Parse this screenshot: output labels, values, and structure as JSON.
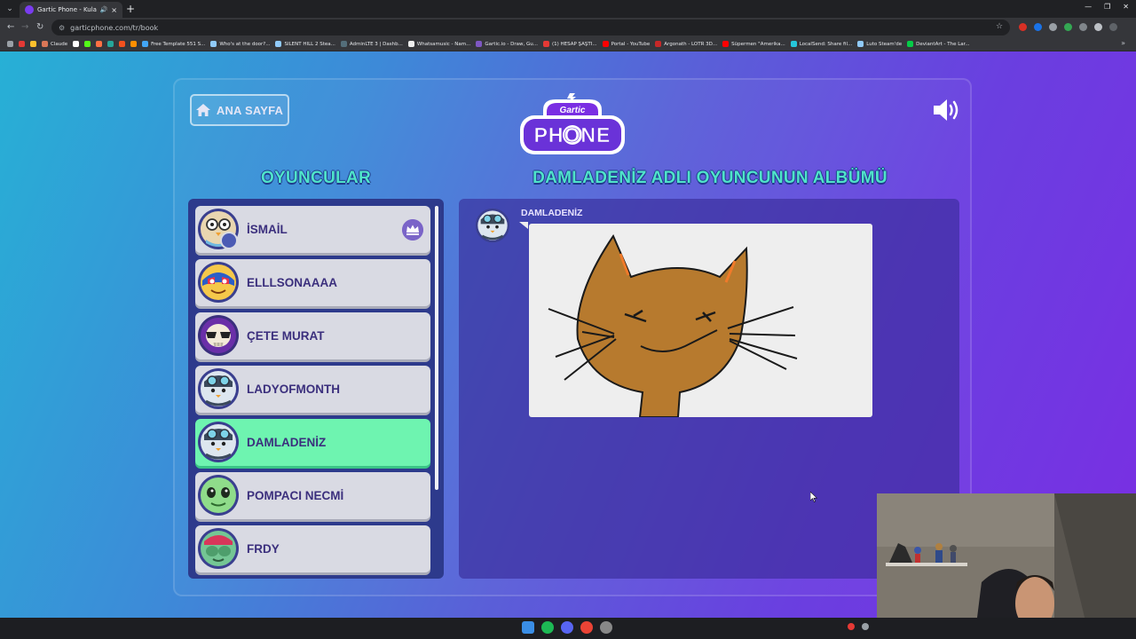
{
  "browser": {
    "tab_title": "Gartic Phone - Kulaktan K...",
    "tab_audio_icon": "speaker-icon",
    "tab_close": "×",
    "new_tab": "+",
    "url": "garticphone.com/tr/book",
    "bookmarks": [
      "Claude",
      "Free Template 551 S...",
      "Who's at the door?...",
      "SILENT HILL 2 Stea...",
      "AdminLTE 3 | Dashb...",
      "Whatsamusic - Nam...",
      "Gartic.io - Draw, Gu...",
      "(1) HESAP ŞAŞTI...",
      "Portal - YouTube",
      "Argonath - LOTR 3D...",
      "Süpermen \"Amerika...",
      "LocalSend: Share fil...",
      "Luto Steam'de",
      "DeviantArt - The Lar..."
    ]
  },
  "page": {
    "home_button": "ANA SAYFA",
    "logo_top": "Gartic",
    "logo_bottom": "PHONE",
    "players_title": "OYUNCULAR",
    "album_title": "DAMLADENİZ ADLI OYUNCUNUN ALBÜMÜ",
    "players": [
      {
        "name": "İSMAİL",
        "host": true,
        "active": false,
        "avatar": "owl-with-glasses-avatar"
      },
      {
        "name": "ELLLSONAAAA",
        "host": false,
        "active": false,
        "avatar": "wrestler-mask-avatar"
      },
      {
        "name": "ÇETE MURAT",
        "host": false,
        "active": false,
        "avatar": "skull-sunglasses-avatar"
      },
      {
        "name": "LADYOFMONTH",
        "host": false,
        "active": false,
        "avatar": "penguin-goggles-avatar"
      },
      {
        "name": "DAMLADENİZ",
        "host": false,
        "active": true,
        "avatar": "penguin-goggles-avatar"
      },
      {
        "name": "POMPACI NECMİ",
        "host": false,
        "active": false,
        "avatar": "alien-avatar"
      },
      {
        "name": "FRDY",
        "host": false,
        "active": false,
        "avatar": "monkey-hands-avatar"
      }
    ],
    "album_entry": {
      "author": "DAMLADENİZ",
      "drawing": "cat-drawing"
    }
  },
  "colors": {
    "accent_title": "#4fe3c9",
    "active_row": "#6ef4b0",
    "panel": "#2d3a8c",
    "row": "#d9dae3",
    "name_text": "#3b2f7d"
  }
}
